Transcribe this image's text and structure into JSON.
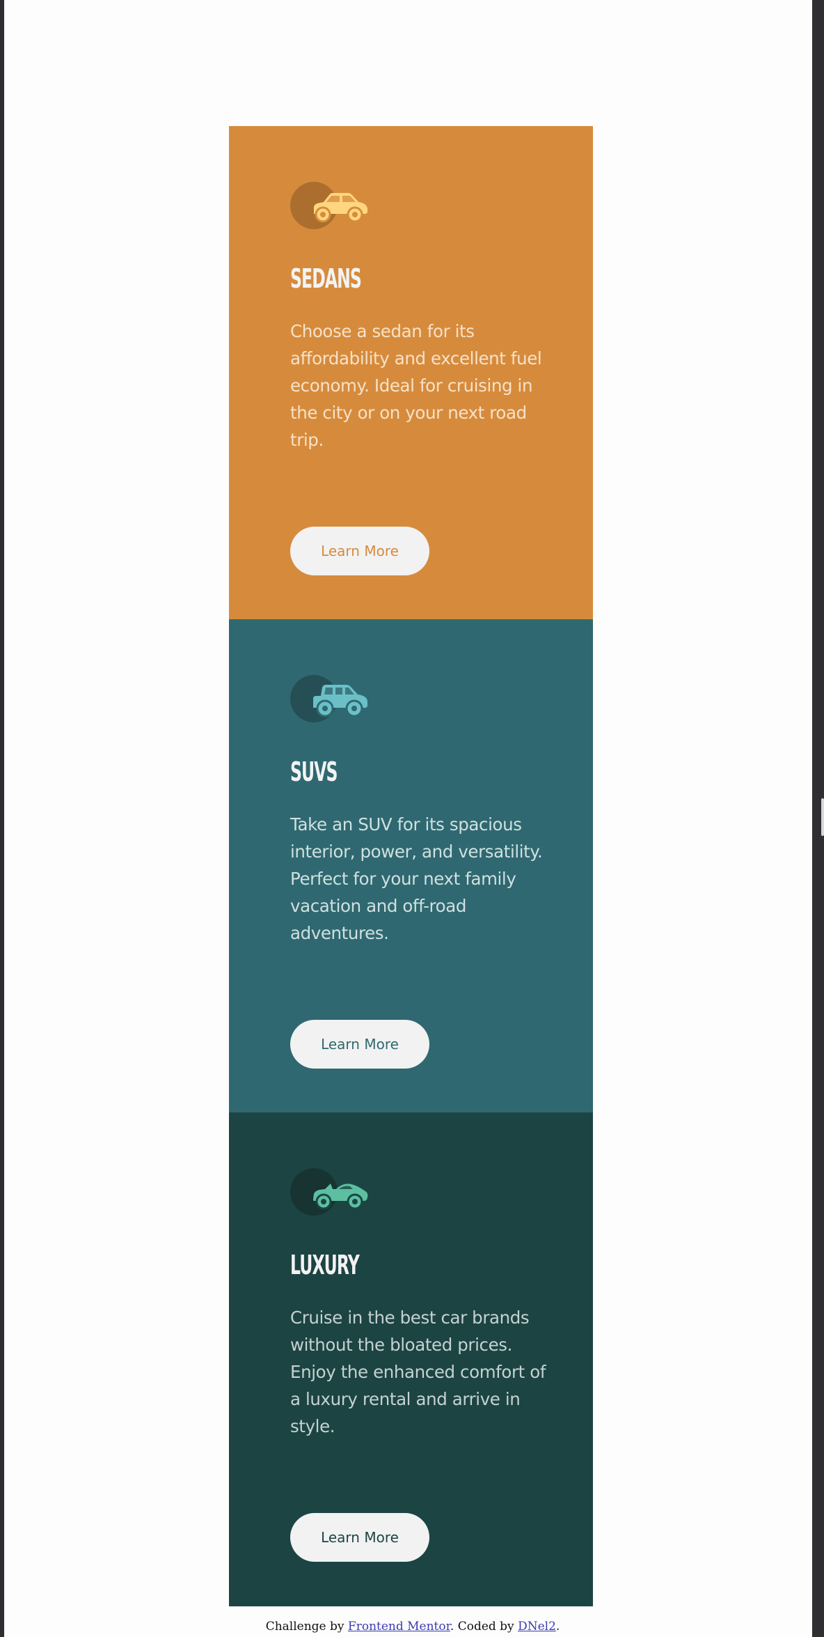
{
  "colors": {
    "sedans": "#d68b3c",
    "suvs": "#2f6870",
    "luxury": "#1c4443",
    "sedans_icon": "#ffd67f",
    "suvs_icon": "#6bc0c8",
    "luxury_icon": "#5cbfa0",
    "button_background": "#f2f2f2",
    "page_background": "#fdfdfd"
  },
  "cards": [
    {
      "icon": "sedan-car-icon",
      "title": "SEDANS",
      "text": "Choose a sedan for its affordability and excellent fuel economy. Ideal for cruising in the city or on your next road trip.",
      "button": "Learn More"
    },
    {
      "icon": "suv-car-icon",
      "title": "SUVS",
      "text": "Take an SUV for its spacious interior, power, and versatility. Perfect for your next family vacation and off-road adventures.",
      "button": "Learn More"
    },
    {
      "icon": "luxury-car-icon",
      "title": "LUXURY",
      "text": "Cruise in the best car brands without the bloated prices. Enjoy the enhanced comfort of a luxury rental and arrive in style.",
      "button": "Learn More"
    }
  ],
  "attribution": {
    "prefix": "Challenge by ",
    "link1": "Frontend Mentor",
    "middle": ". Coded by ",
    "link2": "DNel2",
    "suffix": "."
  }
}
